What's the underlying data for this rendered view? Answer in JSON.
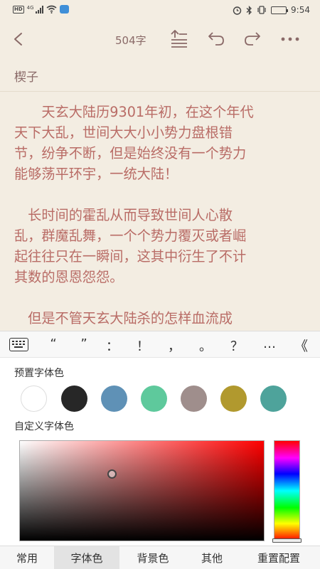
{
  "status_bar": {
    "hd_label": "HD",
    "network_label": "4G",
    "time": "9:54",
    "battery_level": 0.4
  },
  "toolbar": {
    "word_count": "504字",
    "icons": [
      "back-icon",
      "format-icon",
      "undo-icon",
      "redo-icon",
      "more-icon"
    ]
  },
  "chapter": {
    "title": "楔子"
  },
  "content": {
    "paragraphs": [
      [
        "　　天玄大陆历9301年初，在这个年代",
        "天下大乱，世间大大小小势力盘根错",
        "节，纷争不断，但是始终没有一个势力",
        "能够荡平环宇，一统大陆！"
      ],
      [
        "　长时间的霍乱从而导致世间人心散",
        "乱，群魔乱舞，一个个势力覆灭或者崛",
        "起往往只在一瞬间，这其中衍生了不计",
        "其数的恩恩怨怨。"
      ],
      [
        "　但是不管天玄大陆杀的怎样血流成"
      ]
    ]
  },
  "punctuation_bar": {
    "keys": [
      "“",
      "”",
      "：",
      "！",
      "，",
      "。",
      "？",
      "…"
    ],
    "collapse_label": "《"
  },
  "panel": {
    "preset_label": "预置字体色",
    "custom_label": "自定义字体色",
    "preset_colors": [
      "#ffffff",
      "#272727",
      "#5f91b6",
      "#5ec99c",
      "#9f8e8c",
      "#b1992e",
      "#4ea39b"
    ],
    "picker_hue": "#ff0000"
  },
  "tabs": {
    "items": [
      {
        "label": "常用",
        "active": false
      },
      {
        "label": "字体色",
        "active": true
      },
      {
        "label": "背景色",
        "active": false
      },
      {
        "label": "其他",
        "active": false
      },
      {
        "label": "重置配置",
        "active": false
      }
    ]
  },
  "colors": {
    "app_bg": "#f3ede2",
    "text": "#b96c66",
    "toolbar_text": "#8a6a68"
  }
}
